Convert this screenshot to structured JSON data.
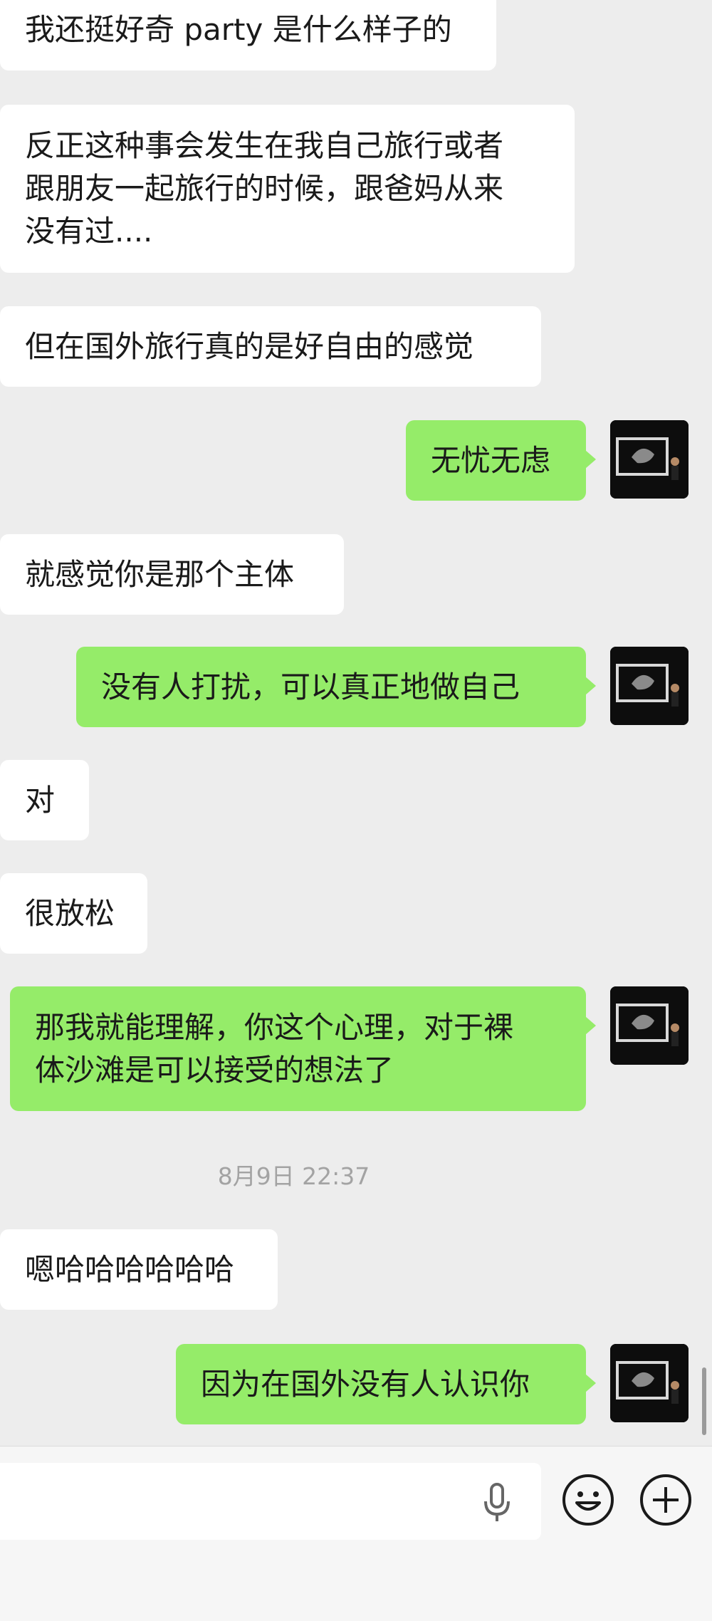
{
  "messages": [
    {
      "side": "received",
      "text": "我还挺好奇 party 是什么样子的"
    },
    {
      "side": "received",
      "text": "反正这种事会发生在我自己旅行或者\n跟朋友一起旅行的时候，跟爸妈从来\n没有过...."
    },
    {
      "side": "received",
      "text": "但在国外旅行真的是好自由的感觉"
    },
    {
      "side": "sent",
      "text": "无忧无虑"
    },
    {
      "side": "received",
      "text": "就感觉你是那个主体"
    },
    {
      "side": "sent",
      "text": "没有人打扰，可以真正地做自己"
    },
    {
      "side": "received",
      "text": "对"
    },
    {
      "side": "received",
      "text": "很放松"
    },
    {
      "side": "sent",
      "text": "那我就能理解，你这个心理，对于裸\n体沙滩是可以接受的想法了"
    },
    {
      "side": "received",
      "text": "嗯哈哈哈哈哈哈"
    },
    {
      "side": "sent",
      "text": "因为在国外没有人认识你"
    }
  ],
  "timestamp": "8月9日 22:37",
  "input_bar": {
    "voice_icon": "microphone-icon",
    "emoji_icon": "emoji-icon",
    "more_icon": "plus-icon"
  },
  "colors": {
    "background": "#ededed",
    "received_bubble": "#ffffff",
    "sent_bubble": "#95ec69",
    "text": "#1a1a1a",
    "timestamp": "#a3a3a3"
  }
}
